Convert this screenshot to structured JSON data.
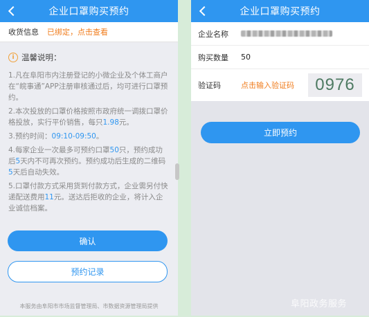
{
  "left": {
    "title": "企业口罩购买预约",
    "address_label": "收货信息",
    "address_status": "已绑定，点击查看",
    "notice_title": "温馨说明：",
    "notice": {
      "p1": "1.凡在阜阳市内注册登记的小微企业及个体工商户在“皖事通”APP注册审核通过后，均可进行口罩预约。",
      "p2_pre": "2.本次投放的口罩价格按照市政府统一调拨口罩价格投放，实行平价销售，每只",
      "p2_price": "1.98",
      "p2_post": "元。",
      "p3_pre": "3.预约时间：",
      "p3_time": "09:10-09:50",
      "p3_post": "。",
      "p4_a": "4.每家企业一次最多可预约口罩",
      "p4_n1": "50",
      "p4_b": "只，预约成功后",
      "p4_n2": "5",
      "p4_c": "天内不可再次预约。预约成功后生成的二维码",
      "p4_n3": "5",
      "p4_d": "天后自动失效。",
      "p5_a": "5.口罩付款方式采用货到付款方式，企业需另付快递配送费用",
      "p5_fee": "11",
      "p5_b": "元。送达后拒收的企业，将计入企业诚信档案。"
    },
    "confirm_label": "确认",
    "records_label": "预约记录",
    "footer": "本服务由阜阳市市场监督管理局、市数据资源管理局提供"
  },
  "right": {
    "title": "企业口罩购买预约",
    "company_label": "企业名称",
    "quantity_label": "购买数量",
    "quantity_value": "50",
    "captcha_label": "验证码",
    "captcha_placeholder": "点击输入验证码",
    "captcha_code": "0976",
    "reserve_label": "立即预约"
  },
  "watermark": "阜阳政务服务",
  "colors": {
    "primary": "#2f96f0",
    "accent": "#f07d1e",
    "info_icon": "#f0a13a",
    "captcha_text": "#4e7a62"
  },
  "icons": {
    "back": "chevron-left-icon",
    "info": "info-circle-icon"
  }
}
